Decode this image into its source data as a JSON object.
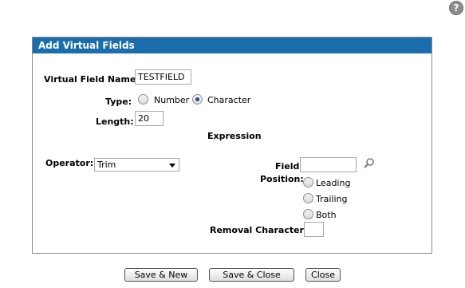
{
  "help": {
    "icon": "help-icon",
    "glyph": "?"
  },
  "panel": {
    "title": "Add Virtual Fields",
    "header_color": "#1a6eab"
  },
  "form": {
    "virtual_field_name_label": "Virtual Field Name:",
    "virtual_field_name_value": "TESTFIELD",
    "type_label": "Type:",
    "type_options": [
      "Number",
      "Character"
    ],
    "type_selected": "Character",
    "length_label": "Length:",
    "length_value": "20",
    "expression_heading": "Expression",
    "operator_label": "Operator:",
    "operator_value": "Trim",
    "field_label": "Field:",
    "field_value": "",
    "field_lookup_icon": "search-icon",
    "position_label": "Position:",
    "position_options": [
      "Leading",
      "Trailing",
      "Both"
    ],
    "position_selected": "",
    "removal_character_label": "Removal Character:",
    "removal_character_value": ""
  },
  "buttons": {
    "save_new": "Save & New",
    "save_close": "Save & Close",
    "close": "Close"
  }
}
